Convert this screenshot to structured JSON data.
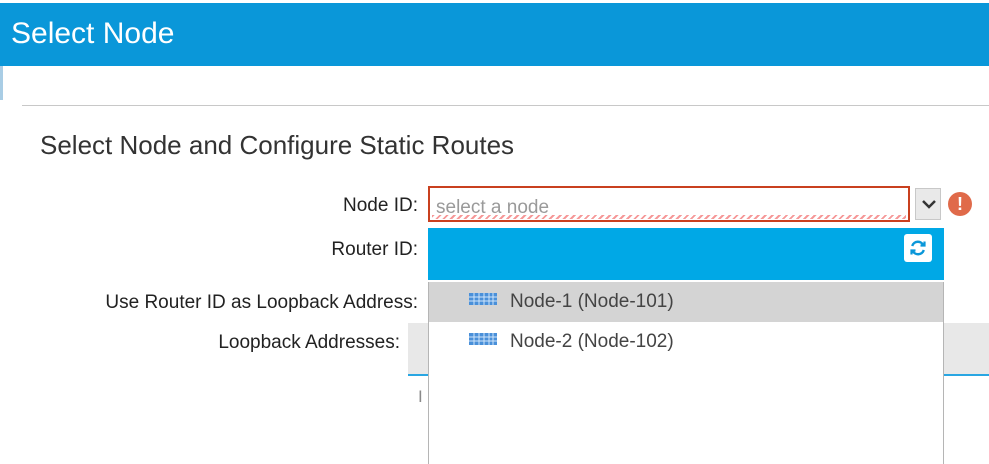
{
  "window": {
    "title": "Select Node"
  },
  "section": {
    "heading": "Select Node and Configure Static Routes"
  },
  "form": {
    "node_id_label": "Node ID:",
    "node_id_placeholder": "select a node",
    "router_id_label": "Router ID:",
    "use_router_id_label": "Use Router ID as Loopback Address:",
    "loopback_addresses_label": "Loopback Addresses:"
  },
  "dropdown": {
    "items": [
      {
        "label": "Node-1 (Node-101)",
        "highlighted": true
      },
      {
        "label": "Node-2 (Node-102)",
        "highlighted": false
      }
    ]
  },
  "background_panel": {
    "fragment": "I"
  },
  "icons": {
    "chevron": "chevron-down-icon",
    "error": "error-icon",
    "refresh": "refresh-icon",
    "node": "node-icon"
  },
  "colors": {
    "title_bar": "#0a97d9",
    "router_bar": "#00a8e6",
    "error": "#e06a4a",
    "invalid_border": "#c9401f",
    "highlight": "#d4d4d4"
  }
}
